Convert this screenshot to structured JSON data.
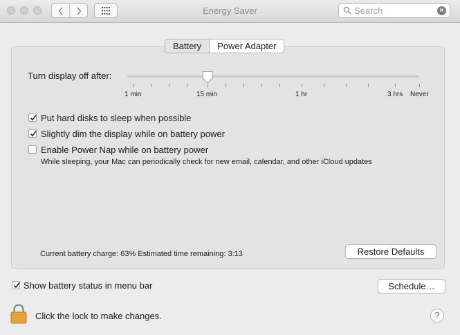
{
  "window": {
    "title": "Energy Saver"
  },
  "toolbar": {
    "back_icon": "chevron-left-icon",
    "forward_icon": "chevron-right-icon",
    "show_all_icon": "grid-icon"
  },
  "search": {
    "placeholder": "Search",
    "value": ""
  },
  "tabs": [
    {
      "label": "Battery",
      "selected": true
    },
    {
      "label": "Power Adapter",
      "selected": false
    }
  ],
  "display_sleep": {
    "label": "Turn display off after:",
    "value": "15 min",
    "ticks": [
      "1 min",
      "15 min",
      "1 hr",
      "3 hrs",
      "Never"
    ]
  },
  "options": [
    {
      "label": "Put hard disks to sleep when possible",
      "checked": true
    },
    {
      "label": "Slightly dim the display while on battery power",
      "checked": true
    },
    {
      "label": "Enable Power Nap while on battery power",
      "checked": false
    }
  ],
  "power_nap_description": "While sleeping, your Mac can periodically check for new email, calendar, and other iCloud updates",
  "battery_status": "Current battery charge: 63%  Estimated time remaining: 3:13",
  "restore_defaults_label": "Restore Defaults",
  "show_battery_status": {
    "label": "Show battery status in menu bar",
    "checked": true
  },
  "schedule_label": "Schedule…",
  "lock_text": "Click the lock to make changes.",
  "help_label": "?"
}
